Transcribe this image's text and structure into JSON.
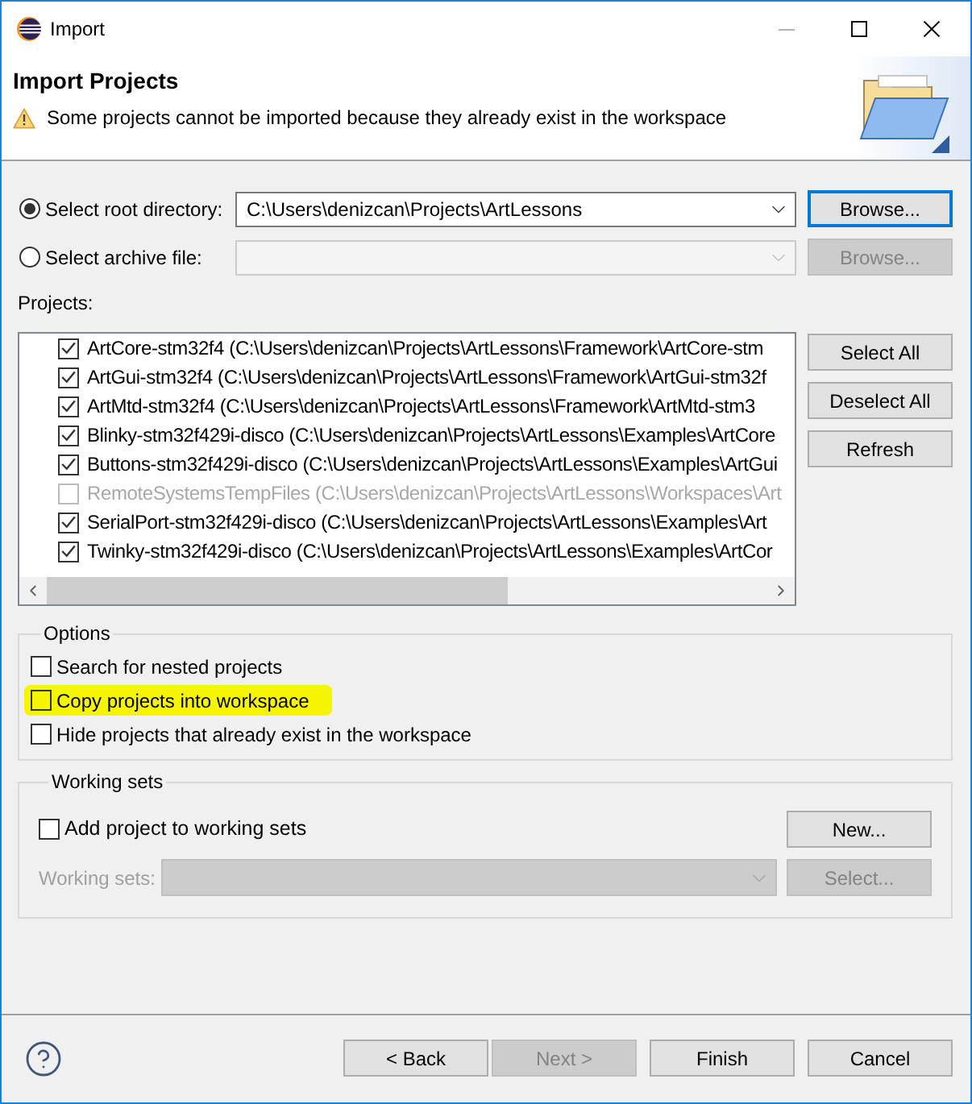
{
  "window": {
    "title": "Import"
  },
  "header": {
    "title": "Import Projects",
    "message": "Some projects cannot be imported because they already exist in the workspace"
  },
  "source": [
    {
      "label": "Select root directory:",
      "selected": true,
      "value": "C:\\Users\\denizcan\\Projects\\ArtLessons",
      "disabled": false,
      "button": {
        "label": "Browse...",
        "focused": true
      }
    },
    {
      "label": "Select archive file:",
      "selected": false,
      "disabled": true,
      "button": {
        "label": "Browse...",
        "focused": false
      }
    }
  ],
  "projects": {
    "label": "Projects:",
    "items": [
      {
        "label": "ArtCore-stm32f4 (C:\\Users\\denizcan\\Projects\\ArtLessons\\Framework\\ArtCore-stm",
        "checked": true,
        "disabled": false
      },
      {
        "label": "ArtGui-stm32f4 (C:\\Users\\denizcan\\Projects\\ArtLessons\\Framework\\ArtGui-stm32f",
        "checked": true,
        "disabled": false
      },
      {
        "label": "ArtMtd-stm32f4 (C:\\Users\\denizcan\\Projects\\ArtLessons\\Framework\\ArtMtd-stm3",
        "checked": true,
        "disabled": false
      },
      {
        "label": "Blinky-stm32f429i-disco (C:\\Users\\denizcan\\Projects\\ArtLessons\\Examples\\ArtCore",
        "checked": true,
        "disabled": false
      },
      {
        "label": "Buttons-stm32f429i-disco (C:\\Users\\denizcan\\Projects\\ArtLessons\\Examples\\ArtGui",
        "checked": true,
        "disabled": false
      },
      {
        "label": "RemoteSystemsTempFiles (C:\\Users\\denizcan\\Projects\\ArtLessons\\Workspaces\\Art",
        "checked": false,
        "disabled": true
      },
      {
        "label": "SerialPort-stm32f429i-disco (C:\\Users\\denizcan\\Projects\\ArtLessons\\Examples\\Art",
        "checked": true,
        "disabled": false
      },
      {
        "label": "Twinky-stm32f429i-disco (C:\\Users\\denizcan\\Projects\\ArtLessons\\Examples\\ArtCor",
        "checked": true,
        "disabled": false
      }
    ],
    "buttons": [
      "Select All",
      "Deselect All",
      "Refresh"
    ]
  },
  "options": {
    "title": "Options",
    "items": [
      {
        "label": "Search for nested projects",
        "checked": false,
        "highlighted": false
      },
      {
        "label": "Copy projects into workspace",
        "checked": false,
        "highlighted": true
      },
      {
        "label": "Hide projects that already exist in the workspace",
        "checked": false,
        "highlighted": false
      }
    ]
  },
  "working_sets": {
    "title": "Working sets",
    "add": {
      "label": "Add project to working sets",
      "checked": false
    },
    "new_button": "New...",
    "sets_label": "Working sets:",
    "select_button": "Select...",
    "disabled": true
  },
  "footer": {
    "buttons": [
      {
        "label": "< Back",
        "disabled": false
      },
      {
        "label": "Next >",
        "disabled": true
      },
      {
        "label": "Finish",
        "disabled": false
      },
      {
        "label": "Cancel",
        "disabled": false
      }
    ]
  }
}
